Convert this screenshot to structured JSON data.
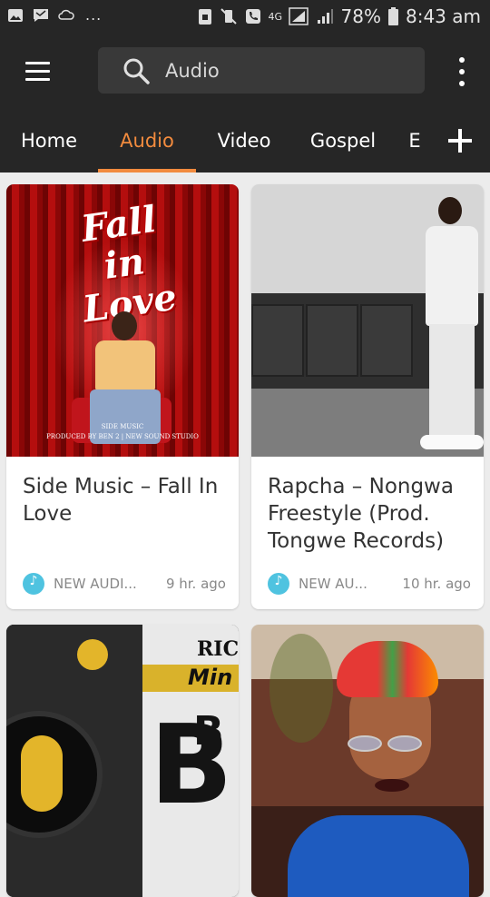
{
  "status_bar": {
    "battery": "78%",
    "time": "8:43 am",
    "network": "4G",
    "more_notifications": "..."
  },
  "toolbar": {
    "search_text": "Audio"
  },
  "tabs": [
    {
      "label": "Home"
    },
    {
      "label": "Audio"
    },
    {
      "label": "Video"
    },
    {
      "label": "Gospel"
    },
    {
      "label": "E"
    }
  ],
  "cards": [
    {
      "title": "Side Music – Fall In Love",
      "category": "NEW AUDI...",
      "time": "9 hr. ago",
      "thumb_title": "Fall in Love",
      "thumb_credit_1": "SIDE MUSIC",
      "thumb_credit_2": "PRODUCED BY BEN 2 | NEW SOUND STUDIO"
    },
    {
      "title": "Rapcha – Nongwa Freestyle (Prod. Tongwe Records)",
      "category": "NEW AU...",
      "time": "10 hr. ago"
    },
    {
      "thumb_text_1": "RICH",
      "thumb_text_2": "Min",
      "thumb_text_3": "B"
    },
    {}
  ],
  "colors": {
    "accent": "#f28b3e",
    "app_bar": "#262626",
    "category_icon": "#4fc3e0"
  }
}
